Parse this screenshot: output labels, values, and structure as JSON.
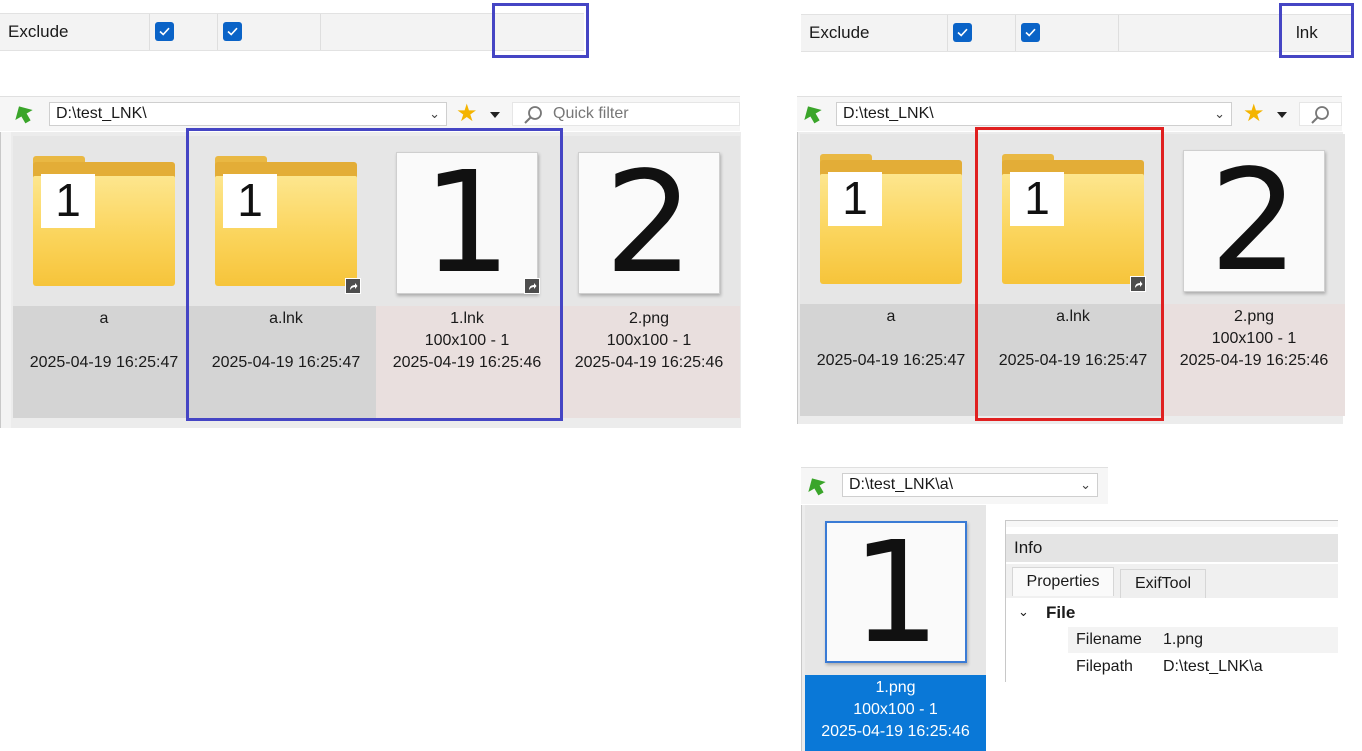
{
  "left": {
    "exclude_row": {
      "label": "Exclude",
      "value": ""
    },
    "toolbar": {
      "path": "D:\\test_LNK\\",
      "quick_filter_placeholder": "Quick filter"
    },
    "tiles": [
      {
        "name": "a",
        "dims": "",
        "date": "2025-04-19 16:25:47",
        "thumb_number": "1"
      },
      {
        "name": "a.lnk",
        "dims": "",
        "date": "2025-04-19 16:25:47",
        "thumb_number": "1"
      },
      {
        "name": "1.lnk",
        "dims": "100x100 - 1",
        "date": "2025-04-19 16:25:46",
        "thumb_number": "1"
      },
      {
        "name": "2.png",
        "dims": "100x100 - 1",
        "date": "2025-04-19 16:25:46",
        "thumb_number": "2"
      }
    ]
  },
  "right": {
    "exclude_row": {
      "label": "Exclude",
      "value": "lnk"
    },
    "toolbar": {
      "path": "D:\\test_LNK\\"
    },
    "tiles": [
      {
        "name": "a",
        "dims": "",
        "date": "2025-04-19 16:25:47",
        "thumb_number": "1"
      },
      {
        "name": "a.lnk",
        "dims": "",
        "date": "2025-04-19 16:25:47",
        "thumb_number": "1"
      },
      {
        "name": "2.png",
        "dims": "100x100 - 1",
        "date": "2025-04-19 16:25:46",
        "thumb_number": "2"
      }
    ]
  },
  "bottom": {
    "toolbar": {
      "path": "D:\\test_LNK\\a\\"
    },
    "tile": {
      "name": "1.png",
      "dims": "100x100 - 1",
      "date": "2025-04-19 16:25:46",
      "thumb_number": "1"
    },
    "info": {
      "header": "Info",
      "tabs": [
        "Properties",
        "ExifTool"
      ],
      "group": "File",
      "rows": [
        {
          "key": "Filename",
          "value": "1.png"
        },
        {
          "key": "Filepath",
          "value": "D:\\test_LNK\\a"
        }
      ]
    }
  },
  "colors": {
    "highlight_blue": "#4545c4",
    "highlight_red": "#e02020",
    "selection": "#0a78d7",
    "checkbox": "#0a63c7"
  }
}
